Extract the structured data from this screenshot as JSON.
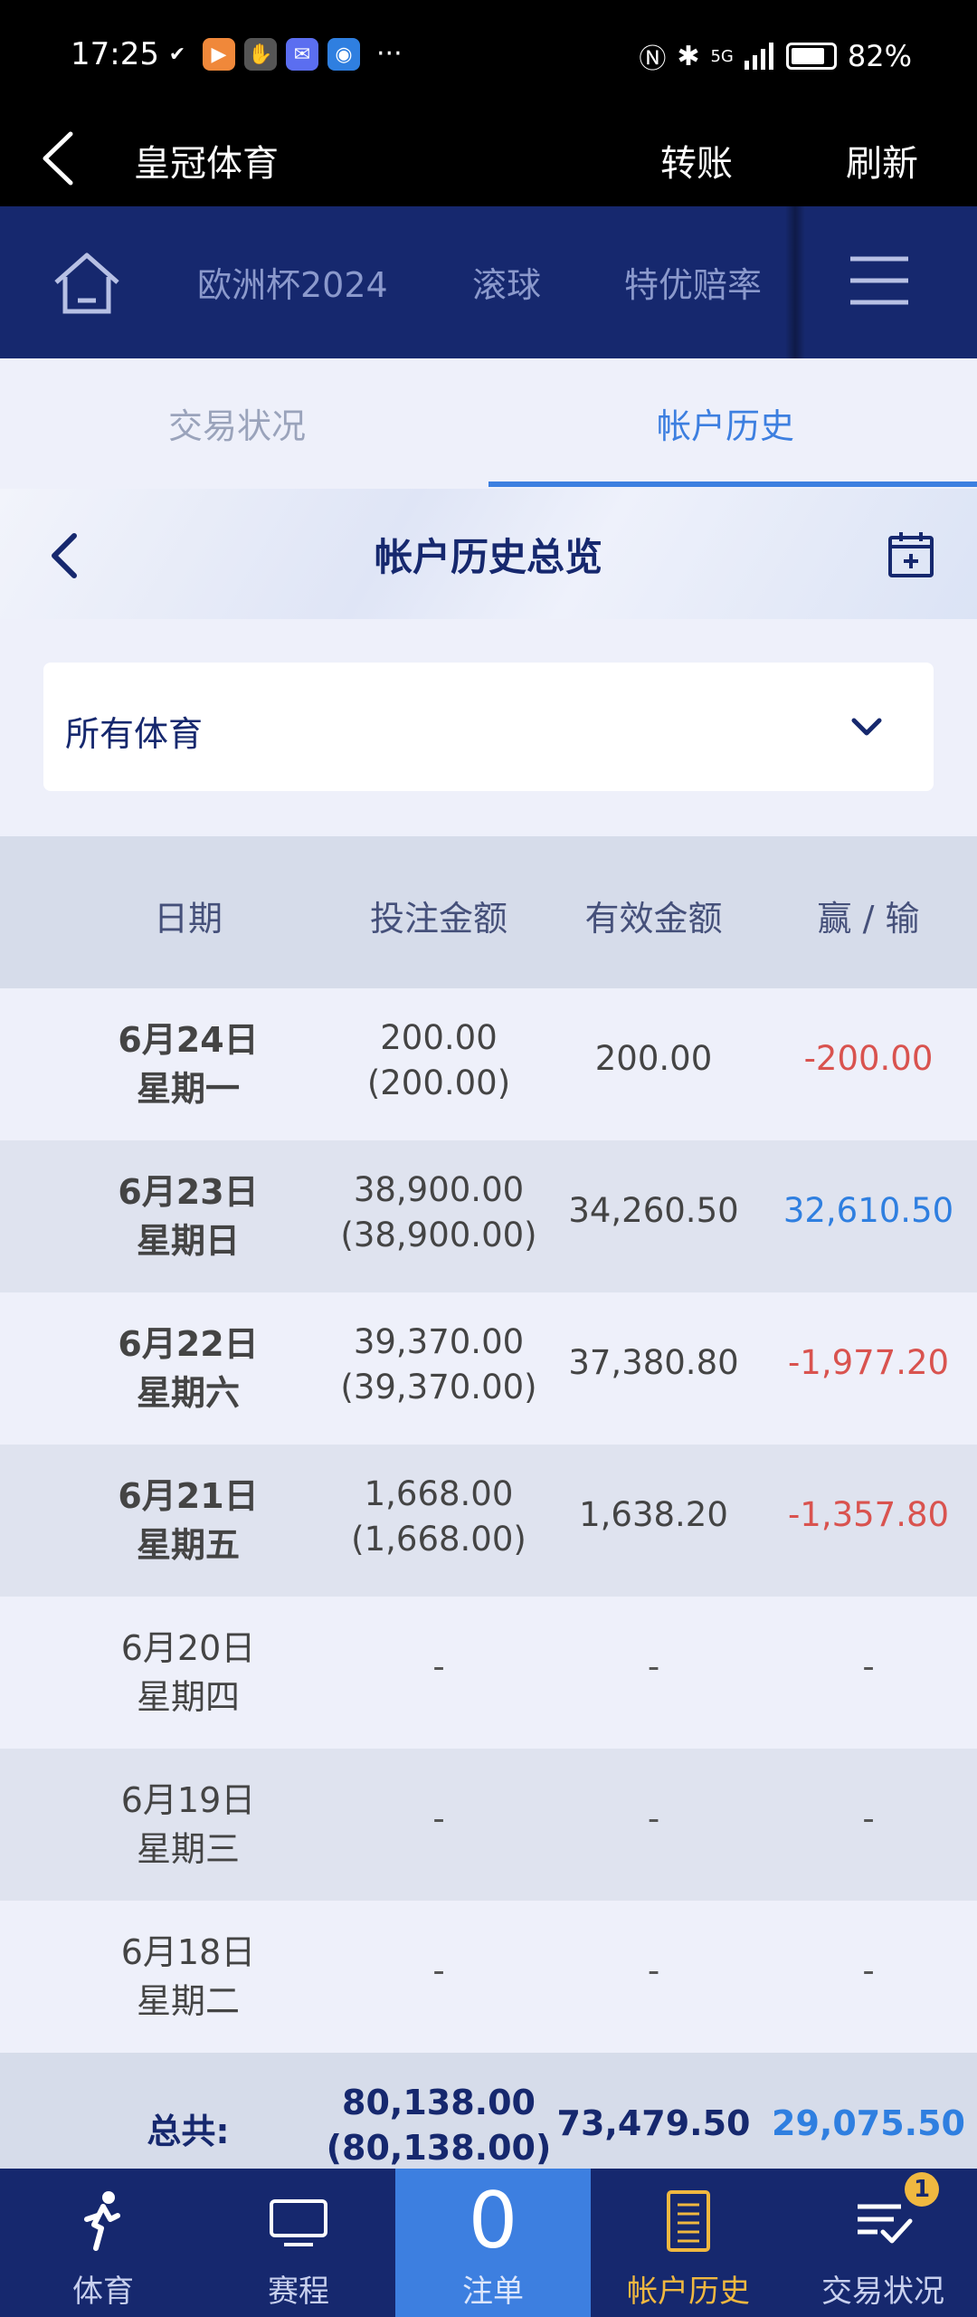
{
  "status_bar": {
    "time": "17:25",
    "battery": "82%",
    "battery_level": 0.82,
    "network": "5G"
  },
  "title_bar": {
    "title": "皇冠体育",
    "transfer": "转账",
    "refresh": "刷新"
  },
  "top_nav": {
    "tabs": [
      "欧洲杯2024",
      "滚球",
      "特优赔率"
    ]
  },
  "sub_tabs": {
    "tabs": [
      "交易状况",
      "帐户历史"
    ],
    "active": 1
  },
  "overview": {
    "title": "帐户历史总览"
  },
  "filter": {
    "selected": "所有体育"
  },
  "table": {
    "headers": [
      "日期",
      "投注金额",
      "有效金额",
      "赢 / 输"
    ],
    "rows": [
      {
        "date": "6月24日",
        "weekday": "星期一",
        "bet": "200.00",
        "bet_paren": "(200.00)",
        "valid": "200.00",
        "winloss": "-200.00"
      },
      {
        "date": "6月23日",
        "weekday": "星期日",
        "bet": "38,900.00",
        "bet_paren": "(38,900.00)",
        "valid": "34,260.50",
        "winloss": "32,610.50"
      },
      {
        "date": "6月22日",
        "weekday": "星期六",
        "bet": "39,370.00",
        "bet_paren": "(39,370.00)",
        "valid": "37,380.80",
        "winloss": "-1,977.20"
      },
      {
        "date": "6月21日",
        "weekday": "星期五",
        "bet": "1,668.00",
        "bet_paren": "(1,668.00)",
        "valid": "1,638.20",
        "winloss": "-1,357.80"
      },
      {
        "date": "6月20日",
        "weekday": "星期四",
        "bet": "-",
        "bet_paren": "",
        "valid": "-",
        "winloss": "-"
      },
      {
        "date": "6月19日",
        "weekday": "星期三",
        "bet": "-",
        "bet_paren": "",
        "valid": "-",
        "winloss": "-"
      },
      {
        "date": "6月18日",
        "weekday": "星期二",
        "bet": "-",
        "bet_paren": "",
        "valid": "-",
        "winloss": "-"
      }
    ],
    "total": {
      "label": "总共:",
      "bet": "80,138.00",
      "bet_paren": "(80,138.00)",
      "valid": "73,479.50",
      "winloss": "29,075.50"
    }
  },
  "bottom_nav": {
    "items": [
      "体育",
      "赛程",
      "注单",
      "帐户历史",
      "交易状况"
    ],
    "betslip_count": "0",
    "badge": "1",
    "active": 3
  },
  "colors": {
    "navy": "#16286e",
    "accent_blue": "#3d7fe0",
    "loss_red": "#d9534f",
    "win_blue": "#2f7fe0",
    "gold": "#f0b840"
  }
}
